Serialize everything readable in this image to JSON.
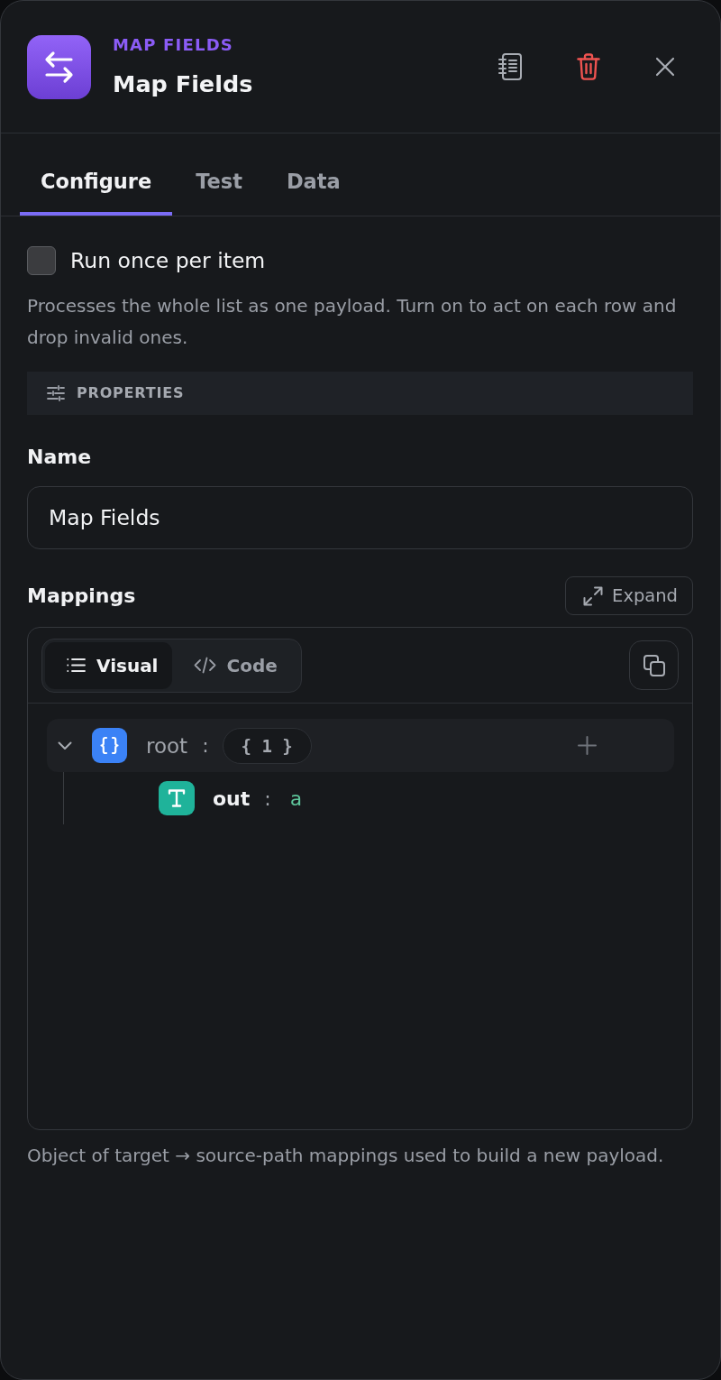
{
  "header": {
    "overline": "MAP FIELDS",
    "title": "Map Fields"
  },
  "tabs": [
    {
      "label": "Configure",
      "selected": true
    },
    {
      "label": "Test",
      "selected": false
    },
    {
      "label": "Data",
      "selected": false
    }
  ],
  "run_once": {
    "label": "Run once per item",
    "checked": false,
    "description": "Processes the whole list as one payload. Turn on to act on each row and drop invalid ones."
  },
  "section": {
    "title": "PROPERTIES"
  },
  "name_field": {
    "label": "Name",
    "value": "Map Fields"
  },
  "mappings": {
    "label": "Mappings",
    "expand_button": "Expand",
    "modes": [
      {
        "label": "Visual",
        "selected": true
      },
      {
        "label": "Code",
        "selected": false
      }
    ],
    "tree": [
      {
        "kind": "object",
        "key": "root",
        "separator": ":",
        "count": "{ 1 }",
        "expanded": true,
        "children": [
          {
            "kind": "text",
            "key": "out",
            "separator": ":",
            "value": "a"
          }
        ]
      }
    ],
    "hint": "Object of target → source-path mappings used to build a new payload."
  }
}
